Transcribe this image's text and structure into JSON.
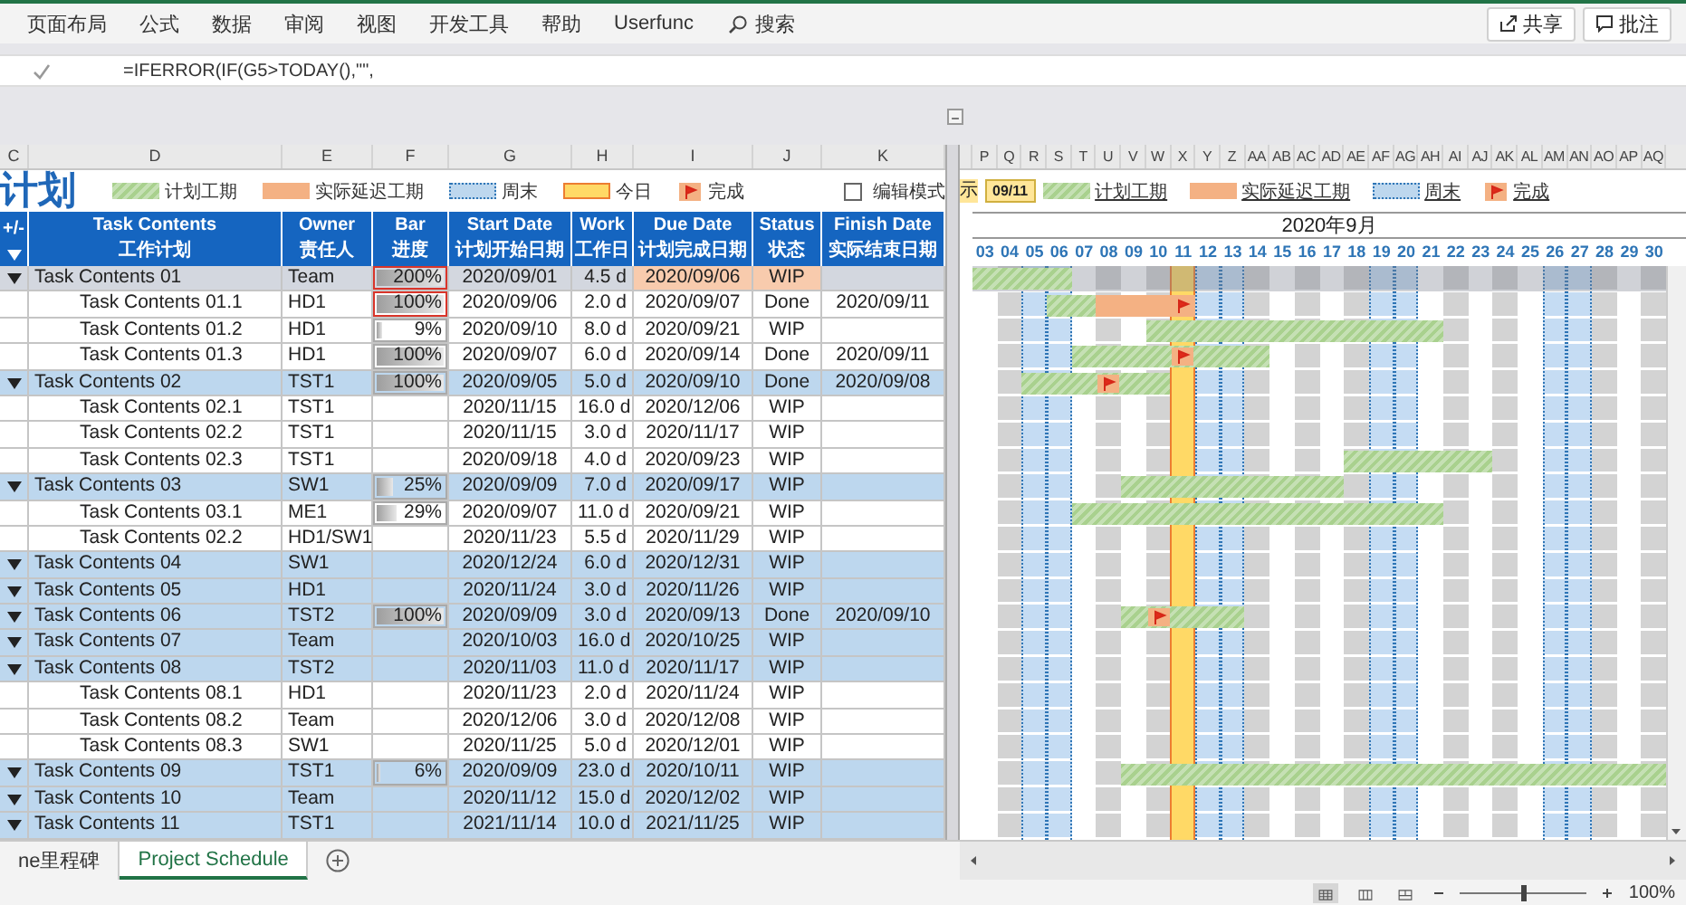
{
  "ribbon": {
    "tabs": [
      "页面布局",
      "公式",
      "数据",
      "审阅",
      "视图",
      "开发工具",
      "帮助",
      "Userfunc"
    ],
    "search": "搜索",
    "share": "共享",
    "comments": "批注"
  },
  "formula_bar": {
    "formula": "=IFERROR(IF(G5>TODAY(),\"\","
  },
  "columns_left": [
    "C",
    "D",
    "E",
    "F",
    "G",
    "H",
    "I",
    "J",
    "K"
  ],
  "columns_right": [
    "P",
    "Q",
    "R",
    "S",
    "T",
    "U",
    "V",
    "W",
    "X",
    "Y",
    "Z",
    "AA",
    "AB",
    "AC",
    "AD",
    "AE",
    "AF",
    "AG",
    "AH",
    "AI",
    "AJ",
    "AK",
    "AL",
    "AM",
    "AN",
    "AO",
    "AP",
    "AQ"
  ],
  "title": "计划",
  "legend": [
    {
      "kind": "plan",
      "label": "计划工期"
    },
    {
      "kind": "delay",
      "label": "实际延迟工期"
    },
    {
      "kind": "weekend",
      "label": "周末"
    },
    {
      "kind": "today",
      "label": "今日"
    },
    {
      "kind": "done",
      "label": "完成"
    }
  ],
  "edit_mode": {
    "label": "编辑模式",
    "checked": false
  },
  "gantt": {
    "today_prefix": "示",
    "today_date": "09/11",
    "legend": [
      {
        "kind": "plan",
        "label": "计划工期"
      },
      {
        "kind": "delay",
        "label": "实际延迟工期"
      },
      {
        "kind": "weekend",
        "label": "周末"
      },
      {
        "kind": "done",
        "label": "完成"
      }
    ],
    "month": "2020年9月",
    "days": [
      {
        "label": "03",
        "weekend": false,
        "today": false
      },
      {
        "label": "04",
        "weekend": false,
        "today": false
      },
      {
        "label": "05",
        "weekend": true,
        "today": false
      },
      {
        "label": "06",
        "weekend": true,
        "today": false
      },
      {
        "label": "07",
        "weekend": false,
        "today": false
      },
      {
        "label": "08",
        "weekend": false,
        "today": false
      },
      {
        "label": "09",
        "weekend": false,
        "today": false
      },
      {
        "label": "10",
        "weekend": false,
        "today": false
      },
      {
        "label": "11",
        "weekend": false,
        "today": true
      },
      {
        "label": "12",
        "weekend": true,
        "today": false
      },
      {
        "label": "13",
        "weekend": true,
        "today": false
      },
      {
        "label": "14",
        "weekend": false,
        "today": false
      },
      {
        "label": "15",
        "weekend": false,
        "today": false
      },
      {
        "label": "16",
        "weekend": false,
        "today": false
      },
      {
        "label": "17",
        "weekend": false,
        "today": false
      },
      {
        "label": "18",
        "weekend": false,
        "today": false
      },
      {
        "label": "19",
        "weekend": true,
        "today": false
      },
      {
        "label": "20",
        "weekend": true,
        "today": false
      },
      {
        "label": "21",
        "weekend": false,
        "today": false
      },
      {
        "label": "22",
        "weekend": false,
        "today": false
      },
      {
        "label": "23",
        "weekend": false,
        "today": false
      },
      {
        "label": "24",
        "weekend": false,
        "today": false
      },
      {
        "label": "25",
        "weekend": false,
        "today": false
      },
      {
        "label": "26",
        "weekend": true,
        "today": false
      },
      {
        "label": "27",
        "weekend": true,
        "today": false
      },
      {
        "label": "28",
        "weekend": false,
        "today": false
      },
      {
        "label": "29",
        "weekend": false,
        "today": false
      },
      {
        "label": "30",
        "weekend": false,
        "today": false
      }
    ]
  },
  "table": {
    "headers": [
      {
        "kind": "toggle",
        "top": "+/-"
      },
      {
        "kind": "text",
        "top": "Task Contents",
        "bottom": "工作计划"
      },
      {
        "kind": "text",
        "top": "Owner",
        "bottom": "责任人"
      },
      {
        "kind": "text",
        "top": "Bar",
        "bottom": "进度"
      },
      {
        "kind": "text",
        "top": "Start Date",
        "bottom": "计划开始日期"
      },
      {
        "kind": "text",
        "top": "Work",
        "bottom": "工作日"
      },
      {
        "kind": "text",
        "top": "Due Date",
        "bottom": "计划完成日期"
      },
      {
        "kind": "text",
        "top": "Status",
        "bottom": "状态"
      },
      {
        "kind": "text",
        "top": "Finish Date",
        "bottom": "实际结束日期"
      }
    ],
    "rows": [
      {
        "task": "Task Contents 01",
        "owner": "Team",
        "progress": {
          "text": "200%",
          "level": 1,
          "alert": true
        },
        "start": "2020/09/01",
        "work": "4.5 d",
        "due": "2020/09/06",
        "status": "WIP",
        "expanded": true,
        "selected": true,
        "overdue": true,
        "children": [
          {
            "task": "Task Contents 01.1",
            "owner": "HD1",
            "progress": {
              "text": "100%",
              "level": 1,
              "alert": true
            },
            "start": "2020/09/06",
            "work": "2.0 d",
            "due": "2020/09/07",
            "status": "Done",
            "finish": "2020/09/11",
            "selected": false,
            "overdue": false
          },
          {
            "task": "Task Contents 01.2",
            "owner": "HD1",
            "progress": {
              "text": "9%",
              "level": 0.09,
              "alert": false
            },
            "start": "2020/09/10",
            "work": "8.0 d",
            "due": "2020/09/21",
            "status": "WIP",
            "selected": false,
            "overdue": false
          },
          {
            "task": "Task Contents 01.3",
            "owner": "HD1",
            "progress": {
              "text": "100%",
              "level": 1,
              "alert": false
            },
            "start": "2020/09/07",
            "work": "6.0 d",
            "due": "2020/09/14",
            "status": "Done",
            "finish": "2020/09/11",
            "selected": false,
            "overdue": false
          }
        ]
      },
      {
        "task": "Task Contents 02",
        "owner": "TST1",
        "progress": {
          "text": "100%",
          "level": 1,
          "alert": false
        },
        "start": "2020/09/05",
        "work": "5.0 d",
        "due": "2020/09/10",
        "status": "Done",
        "finish": "2020/09/08",
        "expanded": true,
        "selected": false,
        "overdue": false,
        "children": [
          {
            "task": "Task Contents 02.1",
            "owner": "TST1",
            "start": "2020/11/15",
            "work": "16.0 d",
            "due": "2020/12/06",
            "status": "WIP",
            "selected": false,
            "overdue": false
          },
          {
            "task": "Task Contents 02.2",
            "owner": "TST1",
            "start": "2020/11/15",
            "work": "3.0 d",
            "due": "2020/11/17",
            "status": "WIP",
            "selected": false,
            "overdue": false
          },
          {
            "task": "Task Contents 02.3",
            "owner": "TST1",
            "start": "2020/09/18",
            "work": "4.0 d",
            "due": "2020/09/23",
            "status": "WIP",
            "selected": false,
            "overdue": false
          }
        ]
      },
      {
        "task": "Task Contents 03",
        "owner": "SW1",
        "progress": {
          "text": "25%",
          "level": 0.25,
          "alert": false
        },
        "start": "2020/09/09",
        "work": "7.0 d",
        "due": "2020/09/17",
        "status": "WIP",
        "expanded": true,
        "selected": false,
        "overdue": false,
        "children": [
          {
            "task": "Task Contents 03.1",
            "owner": "ME1",
            "progress": {
              "text": "29%",
              "level": 0.29,
              "alert": false
            },
            "start": "2020/09/07",
            "work": "11.0 d",
            "due": "2020/09/21",
            "status": "WIP",
            "selected": false,
            "overdue": false
          },
          {
            "task": "Task Contents 02.2",
            "owner": "HD1/SW1",
            "start": "2020/11/23",
            "work": "5.5 d",
            "due": "2020/11/29",
            "status": "WIP",
            "selected": false,
            "overdue": false
          }
        ]
      },
      {
        "task": "Task Contents 04",
        "owner": "SW1",
        "start": "2020/12/24",
        "work": "6.0 d",
        "due": "2020/12/31",
        "status": "WIP",
        "expanded": true,
        "selected": false,
        "overdue": false
      },
      {
        "task": "Task Contents 05",
        "owner": "HD1",
        "start": "2020/11/24",
        "work": "3.0 d",
        "due": "2020/11/26",
        "status": "WIP",
        "expanded": true,
        "selected": false,
        "overdue": false
      },
      {
        "task": "Task Contents 06",
        "owner": "TST2",
        "progress": {
          "text": "100%",
          "level": 1,
          "alert": false
        },
        "start": "2020/09/09",
        "work": "3.0 d",
        "due": "2020/09/13",
        "status": "Done",
        "finish": "2020/09/10",
        "expanded": true,
        "selected": false,
        "overdue": false
      },
      {
        "task": "Task Contents 07",
        "owner": "Team",
        "start": "2020/10/03",
        "work": "16.0 d",
        "due": "2020/10/25",
        "status": "WIP",
        "expanded": true,
        "selected": false,
        "overdue": false
      },
      {
        "task": "Task Contents 08",
        "owner": "TST2",
        "start": "2020/11/03",
        "work": "11.0 d",
        "due": "2020/11/17",
        "status": "WIP",
        "expanded": true,
        "selected": false,
        "overdue": false,
        "children": [
          {
            "task": "Task Contents 08.1",
            "owner": "HD1",
            "start": "2020/11/23",
            "work": "2.0 d",
            "due": "2020/11/24",
            "status": "WIP",
            "selected": false,
            "overdue": false
          },
          {
            "task": "Task Contents 08.2",
            "owner": "Team",
            "start": "2020/12/06",
            "work": "3.0 d",
            "due": "2020/12/08",
            "status": "WIP",
            "selected": false,
            "overdue": false
          },
          {
            "task": "Task Contents 08.3",
            "owner": "SW1",
            "start": "2020/11/25",
            "work": "5.0 d",
            "due": "2020/12/01",
            "status": "WIP",
            "selected": false,
            "overdue": false
          }
        ]
      },
      {
        "task": "Task Contents 09",
        "owner": "TST1",
        "progress": {
          "text": "6%",
          "level": 0.06,
          "alert": false
        },
        "start": "2020/09/09",
        "work": "23.0 d",
        "due": "2020/10/11",
        "status": "WIP",
        "expanded": true,
        "selected": false,
        "overdue": false
      },
      {
        "task": "Task Contents 10",
        "owner": "Team",
        "start": "2020/11/12",
        "work": "15.0 d",
        "due": "2020/12/02",
        "status": "WIP",
        "expanded": true,
        "selected": false,
        "overdue": false
      },
      {
        "task": "Task Contents 11",
        "owner": "TST1",
        "start": "2021/11/14",
        "work": "10.0 d",
        "due": "2021/11/25",
        "status": "WIP",
        "expanded": true,
        "selected": false,
        "overdue": false
      }
    ]
  },
  "sheet_tabs": [
    {
      "label": "ne里程碑",
      "selected": false
    },
    {
      "label": "Project Schedule",
      "selected": true
    }
  ],
  "status_bar": {
    "zoom": {
      "level": 0.5,
      "reading": "100%"
    }
  }
}
